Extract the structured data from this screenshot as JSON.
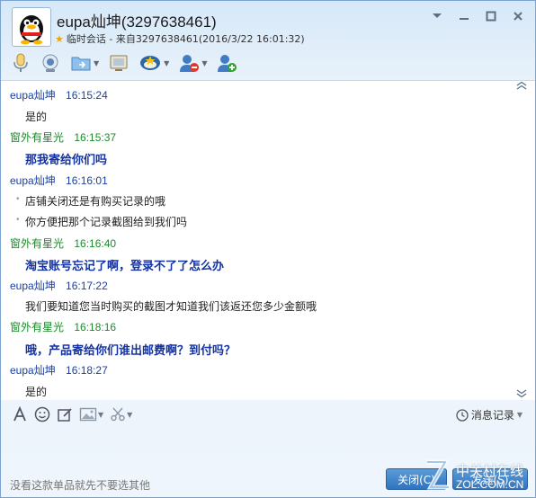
{
  "window": {
    "title": "eupa灿坤(3297638461)",
    "subtitle": "临时会话 - 来自3297638461(2016/3/22 16:01:32)"
  },
  "toolbar": {
    "icons": [
      "microphone-icon",
      "video-call-icon",
      "send-file-icon",
      "screen-share-icon",
      "app-icon",
      "remove-contact-icon",
      "add-contact-icon"
    ]
  },
  "messages": [
    {
      "sender": "eupa灿坤",
      "time": "16:15:24",
      "text": "是的",
      "sender_color": "#1b3fa0"
    },
    {
      "sender": "窗外有星光",
      "time": "16:15:37",
      "text": "那我寄给你们吗",
      "sender_color": "#1a8a2a"
    },
    {
      "sender": "eupa灿坤",
      "time": "16:16:01",
      "lines": [
        "店铺关闭还是有购买记录的哦",
        "你方便把那个记录截图给到我们吗"
      ],
      "sender_color": "#1b3fa0"
    },
    {
      "sender": "窗外有星光",
      "time": "16:16:40",
      "text": "淘宝账号忘记了啊，登录不了了怎么办",
      "sender_color": "#1a8a2a"
    },
    {
      "sender": "eupa灿坤",
      "time": "16:17:22",
      "text": "我们要知道您当时购买的截图才知道我们该返还您多少金额哦",
      "sender_color": "#1b3fa0"
    },
    {
      "sender": "窗外有星光",
      "time": "16:18:16",
      "text": "哦，产品寄给你们谁出邮费啊？到付吗？",
      "sender_color": "#1a8a2a"
    },
    {
      "sender": "eupa灿坤",
      "time": "16:18:27",
      "text": "是的",
      "sender_color": "#1b3fa0"
    }
  ],
  "input": {
    "history_label": "消息记录",
    "draft_text": "没看这款单品就先不要选其他",
    "close_label": "关闭(C)",
    "send_label": "发送(S)"
  },
  "watermark": {
    "brand_cn": "中关村在线",
    "brand_en": "ZOL.COM.CN"
  }
}
